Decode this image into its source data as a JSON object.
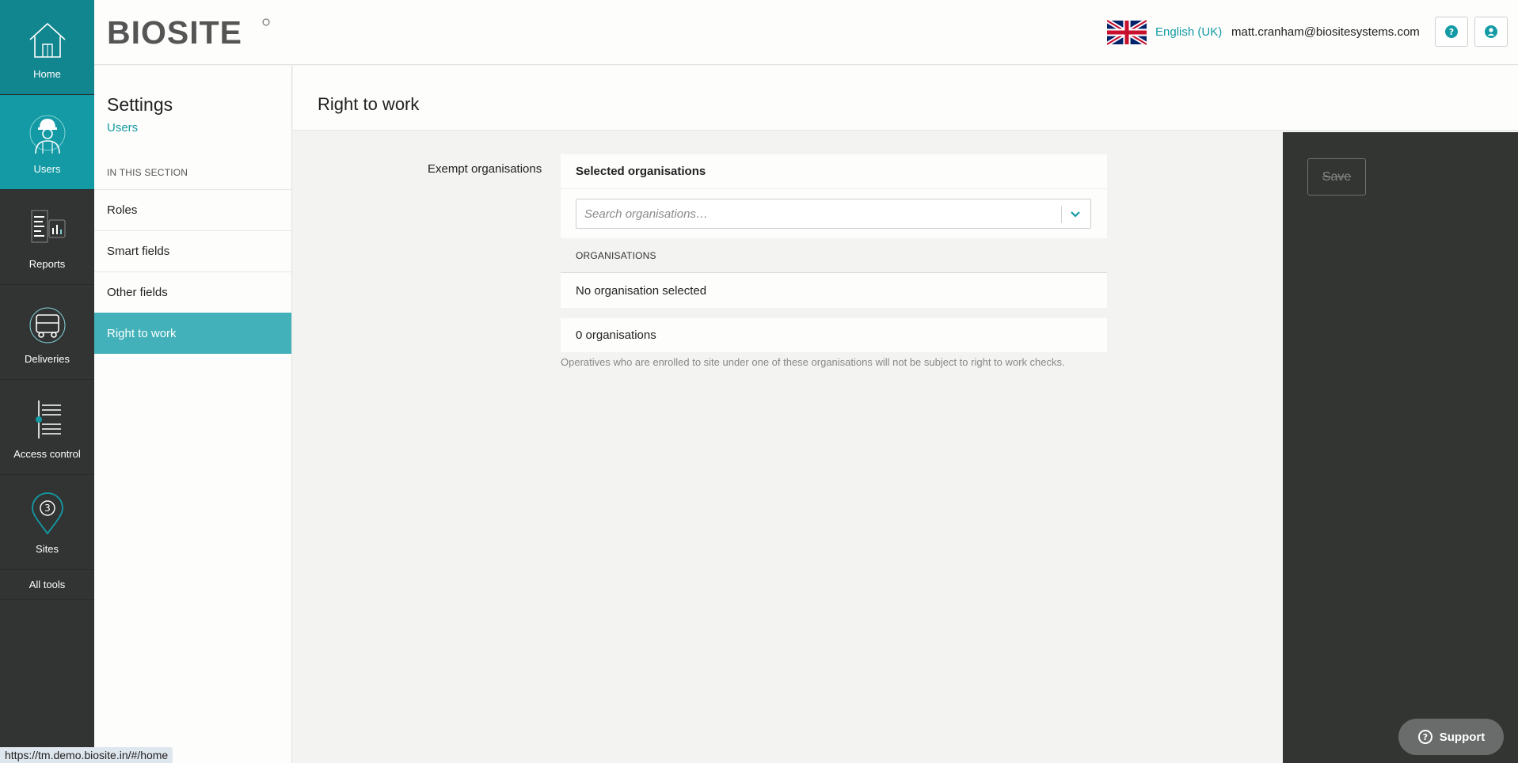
{
  "nav": {
    "items": [
      {
        "label": "Home",
        "icon": "home-icon"
      },
      {
        "label": "Users",
        "icon": "worker-icon"
      },
      {
        "label": "Reports",
        "icon": "reports-icon"
      },
      {
        "label": "Deliveries",
        "icon": "truck-icon"
      },
      {
        "label": "Access control",
        "icon": "turnstile-icon"
      },
      {
        "label": "Sites",
        "icon": "map-pin-icon"
      }
    ],
    "all_tools": "All tools"
  },
  "header": {
    "logo_text": "BIOSITE",
    "language": "English (UK)",
    "user_email": "matt.cranham@biositesystems.com"
  },
  "sidebar": {
    "title": "Settings",
    "subtitle": "Users",
    "section_label": "IN THIS SECTION",
    "items": [
      {
        "label": "Roles"
      },
      {
        "label": "Smart fields"
      },
      {
        "label": "Other fields"
      },
      {
        "label": "Right to work"
      }
    ]
  },
  "main": {
    "title": "Right to work",
    "field_label": "Exempt organisations",
    "card_title": "Selected organisations",
    "search_placeholder": "Search organisations…",
    "list_header": "ORGANISATIONS",
    "empty_text": "No organisation selected",
    "count_text": "0 organisations",
    "hint": "Operatives who are enrolled to site under one of these organisations will not be subject to right to work checks."
  },
  "actions": {
    "save_label": "Save",
    "support_label": "Support"
  },
  "status_url": "https://tm.demo.biosite.in/#/home",
  "colors": {
    "accent": "#139aa4",
    "rail_bg": "#323433",
    "active_menu": "#42b1b9"
  }
}
